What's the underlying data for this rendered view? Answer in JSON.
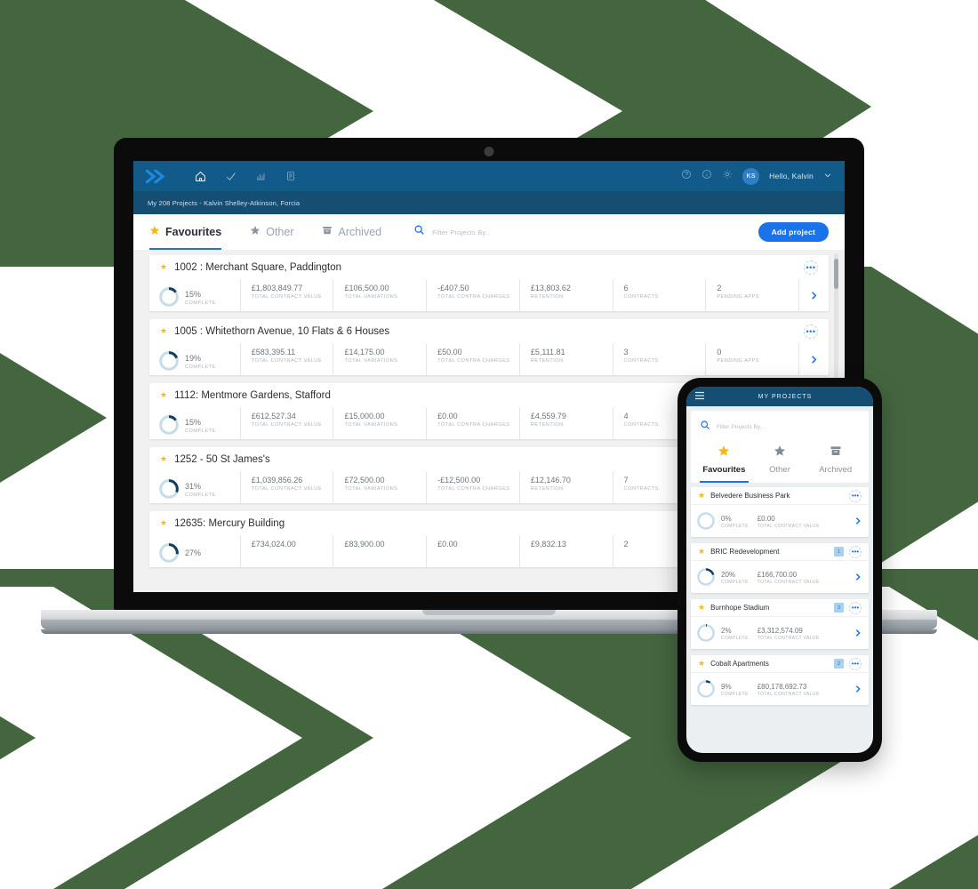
{
  "background": {
    "color": "#44663f",
    "chevron_color": "#ffffff"
  },
  "theme": {
    "nav_blue": "#125a89",
    "subbar_blue": "#154d73",
    "accent_blue": "#1a73e8",
    "star_gold": "#f5b914",
    "ring_track": "#c5dced",
    "ring_fill": "#0d3e63"
  },
  "laptop": {
    "topnav": {
      "logo": "double-chevron-logo",
      "icons": [
        "home-icon",
        "check-icon",
        "chart-icon",
        "report-icon"
      ],
      "right_icons": [
        "help-icon",
        "info-icon",
        "gear-icon"
      ],
      "avatar_initials": "KS",
      "greeting": "Hello, Kalvin",
      "chevron": "chevron-down-icon"
    },
    "subbar": {
      "text": "My 208 Projects - Kalvin Shelley-Atkinson, Forcia"
    },
    "tabs": [
      {
        "label": "Favourites",
        "icon": "star-filled-icon",
        "active": true
      },
      {
        "label": "Other",
        "icon": "star-grey-icon",
        "active": false
      },
      {
        "label": "Archived",
        "icon": "archive-box-icon",
        "active": false
      }
    ],
    "search": {
      "icon": "search-icon",
      "placeholder": "Filter Projects By..",
      "value": ""
    },
    "add_button": {
      "label": "Add project"
    },
    "metric_labels": {
      "complete": "COMPLETE",
      "contract": "TOTAL CONTRACT VALUE",
      "variations": "TOTAL VARIATIONS",
      "contra": "TOTAL CONTRA CHARGES",
      "retention": "RETENTION",
      "contracts": "CONTRACTS",
      "pending": "PENDING APPS"
    },
    "projects": [
      {
        "title": "1002 : Merchant Square, Paddington",
        "percent": "15%",
        "percent_num": 15,
        "contract": "£1,803,849.77",
        "variations": "£106,500.00",
        "contra": "-£407.50",
        "retention": "£13,803.62",
        "contracts": "6",
        "pending": "2"
      },
      {
        "title": "1005 : Whitethorn Avenue, 10 Flats & 6 Houses",
        "percent": "19%",
        "percent_num": 19,
        "contract": "£583,395.11",
        "variations": "£14,175.00",
        "contra": "£50.00",
        "retention": "£5,111.81",
        "contracts": "3",
        "pending": "0"
      },
      {
        "title": "1112: Mentmore Gardens, Stafford",
        "percent": "15%",
        "percent_num": 15,
        "contract": "£612,527.34",
        "variations": "£15,000.00",
        "contra": "£0.00",
        "retention": "£4,559.79",
        "contracts": "4",
        "pending": ""
      },
      {
        "title": "1252 - 50 St James's",
        "percent": "31%",
        "percent_num": 31,
        "contract": "£1,039,856.26",
        "variations": "£72,500.00",
        "contra": "-£12,500.00",
        "retention": "£12,146.70",
        "contracts": "7",
        "pending": ""
      },
      {
        "title": "12635: Mercury Building",
        "percent": "27%",
        "percent_num": 27,
        "contract": "£734,024.00",
        "variations": "£83,900.00",
        "contra": "£0.00",
        "retention": "£9,832.13",
        "contracts": "2",
        "pending": ""
      }
    ]
  },
  "phone": {
    "menu_icon": "hamburger-menu-icon",
    "title": "MY PROJECTS",
    "search": {
      "icon": "search-icon",
      "placeholder": "Filter Projects By..",
      "value": ""
    },
    "tabs": [
      {
        "label": "Favourites",
        "icon": "star-filled-icon",
        "active": true
      },
      {
        "label": "Other",
        "icon": "star-grey-icon",
        "active": false
      },
      {
        "label": "Archived",
        "icon": "archive-box-icon",
        "active": false
      }
    ],
    "metric_labels": {
      "complete": "COMPLETE",
      "contract": "TOTAL CONTRACT VALUE"
    },
    "projects": [
      {
        "title": "Belvedere Business Park",
        "percent": "0%",
        "percent_num": 0,
        "contract": "£0.00",
        "badge": ""
      },
      {
        "title": "BRIC Redevelopment",
        "percent": "20%",
        "percent_num": 20,
        "contract": "£166,700.00",
        "badge": "1"
      },
      {
        "title": "Burnhope Stadium",
        "percent": "2%",
        "percent_num": 2,
        "contract": "£3,312,574.09",
        "badge": "3"
      },
      {
        "title": "Cobalt Apartments",
        "percent": "9%",
        "percent_num": 9,
        "contract": "£80,178,692.73",
        "badge": "2"
      }
    ]
  }
}
